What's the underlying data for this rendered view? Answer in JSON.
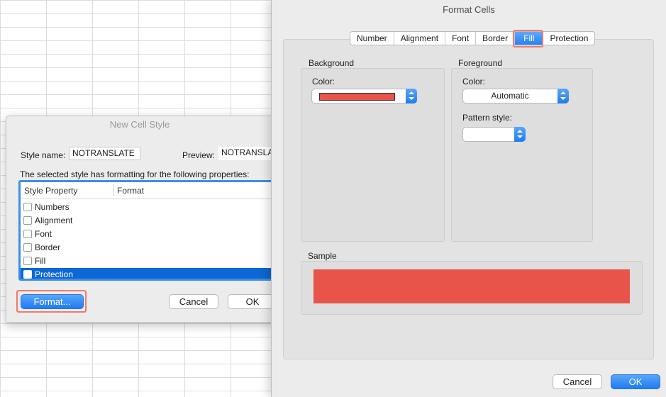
{
  "new_cell_style": {
    "title": "New Cell Style",
    "style_name_label": "Style name:",
    "style_name_value": "NOTRANSLATE",
    "preview_label": "Preview:",
    "preview_value": "NOTRANSLATE",
    "properties_caption": "The selected style has formatting for the following properties:",
    "columns": [
      "Style Property",
      "Format"
    ],
    "properties": [
      {
        "label": "Numbers",
        "checked": false,
        "selected": false
      },
      {
        "label": "Alignment",
        "checked": false,
        "selected": false
      },
      {
        "label": "Font",
        "checked": false,
        "selected": false
      },
      {
        "label": "Border",
        "checked": false,
        "selected": false
      },
      {
        "label": "Fill",
        "checked": false,
        "selected": false
      },
      {
        "label": "Protection",
        "checked": false,
        "selected": true
      }
    ],
    "format_button": "Format...",
    "cancel_button": "Cancel",
    "ok_button": "OK"
  },
  "format_cells": {
    "title": "Format Cells",
    "tabs": [
      "Number",
      "Alignment",
      "Font",
      "Border",
      "Fill",
      "Protection"
    ],
    "active_tab": "Fill",
    "background": {
      "group_label": "Background",
      "color_label": "Color:",
      "color_value": "#e8534a"
    },
    "foreground": {
      "group_label": "Foreground",
      "color_label": "Color:",
      "color_value": "Automatic",
      "pattern_label": "Pattern style:",
      "pattern_value": ""
    },
    "sample_label": "Sample",
    "sample_color": "#e8534a",
    "cancel_button": "Cancel",
    "ok_button": "OK"
  },
  "colors": {
    "accent": "#1f7cf0",
    "highlight": "#f07a6f",
    "selection": "#0d67d4"
  }
}
